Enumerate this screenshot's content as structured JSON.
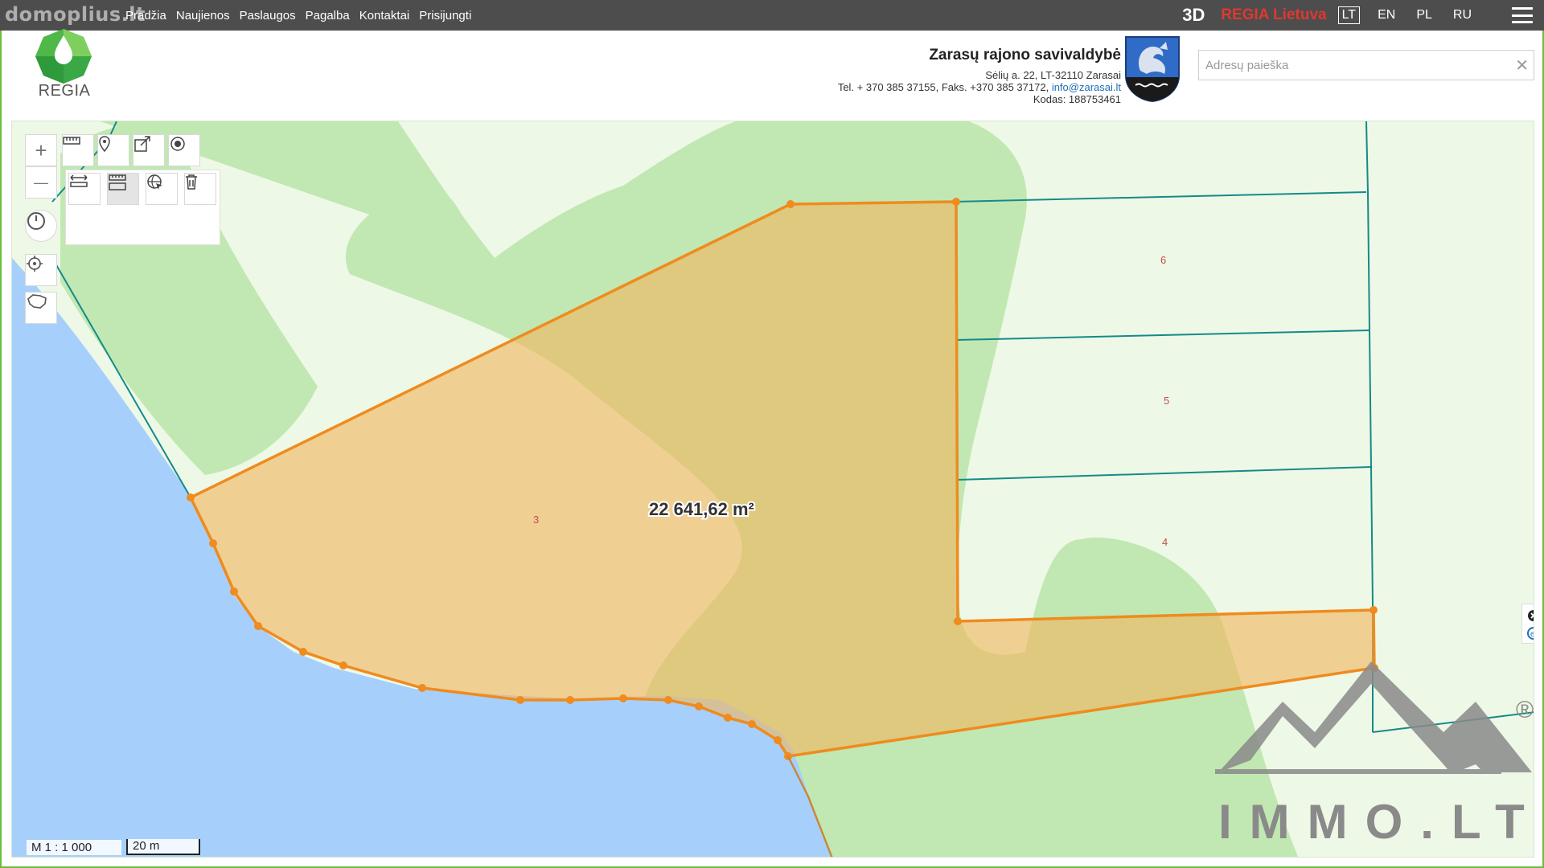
{
  "site": {
    "watermark": "domoplius.lt",
    "nav": [
      "Pradžia",
      "Naujienos",
      "Paslaugos",
      "Pagalba",
      "Kontaktai",
      "Prisijungti"
    ],
    "mode_3d": "3D",
    "portal": "REGIA Lietuva",
    "languages": [
      "LT",
      "EN",
      "PL",
      "RU"
    ],
    "active_language": "LT",
    "logo_text": "REGIA"
  },
  "municipality": {
    "name": "Zarasų rajono savivaldybė",
    "address": "Sėlių a. 22, LT-32110 Zarasai",
    "phones": "Tel. + 370 385 37155, Faks. +370 385 37172, ",
    "email": "info@zarasai.lt",
    "code": "Kodas: 188753461"
  },
  "search": {
    "placeholder": "Adresų paieška",
    "value": ""
  },
  "map": {
    "area_label": "22 641,62 m²",
    "parcel_numbers": [
      "3",
      "4",
      "5",
      "6"
    ],
    "scale_ratio": "M 1 : 1 000",
    "scale_bar": "20 m",
    "overlay_brand": "IMMO.LT",
    "overlay_registered": "®",
    "colors": {
      "water": "#a6d0fb",
      "forest": "#c1e8b2",
      "meadow": "#eef8e6",
      "selection_fill": "#f0b660",
      "selection_stroke": "#ef8b1f",
      "parcel_line": "#158a8a",
      "parcel_number": "#c0504d"
    }
  },
  "tools": {
    "zoom_in": "+",
    "zoom_out": "—"
  }
}
